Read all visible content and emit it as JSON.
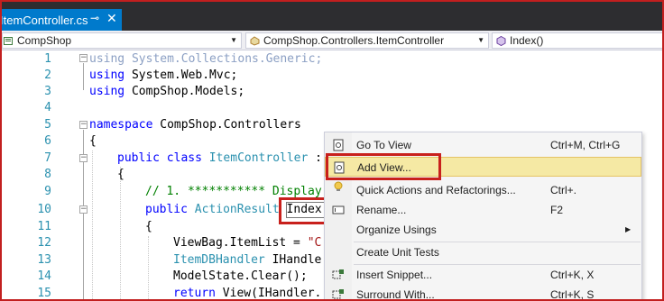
{
  "tab": {
    "title": "ItemController.cs",
    "pin_glyph": "⊸",
    "close_glyph": "✕"
  },
  "navbar": {
    "project": "CompShop",
    "class": "CompShop.Controllers.ItemController",
    "member": "Index()"
  },
  "editor": {
    "line_numbers": [
      "1",
      "2",
      "3",
      "4",
      "5",
      "6",
      "7",
      "8",
      "9",
      "10",
      "11",
      "12",
      "13",
      "14",
      "15"
    ],
    "fold_plus": "+",
    "fold_minus": "−",
    "lines": {
      "l1_kw": "using",
      "l1_rest": " System.Collections.Generic;",
      "l2_kw": "using",
      "l2_rest": " System.Web.Mvc;",
      "l3_kw": "using",
      "l3_rest": " CompShop.Models;",
      "l5_kw": "namespace",
      "l5_rest": " CompShop.Controllers",
      "l6": "{",
      "l7_kw1": "public",
      "l7_kw2": "class",
      "l7_ty": "ItemController",
      "l7_rest": " :",
      "l8": "{",
      "l9": "// 1. *********** Display",
      "l10_kw": "public",
      "l10_ty": "ActionResult",
      "l10_name": "Index",
      "l11": "{",
      "l12_a": "ViewBag.ItemList = ",
      "l12_str": "\"C",
      "l13_ty": "ItemDBHandler",
      "l13_rest": " IHandle",
      "l14": "ModelState.Clear();",
      "l15_kw": "return",
      "l15_rest": " View(IHandler."
    }
  },
  "context_menu": {
    "items": [
      {
        "label": "Go To View",
        "shortcut": "Ctrl+M, Ctrl+G",
        "icon": "go-to-view-icon"
      },
      {
        "label": "Add View...",
        "shortcut": "",
        "icon": "add-view-icon"
      },
      {
        "label": "Quick Actions and Refactorings...",
        "shortcut": "Ctrl+.",
        "icon": "lightbulb-icon"
      },
      {
        "label": "Rename...",
        "shortcut": "F2",
        "icon": "rename-icon"
      },
      {
        "label": "Organize Usings",
        "shortcut": "",
        "icon": "",
        "submenu_glyph": "▶"
      },
      {
        "label": "Create Unit Tests",
        "shortcut": "",
        "icon": ""
      },
      {
        "label": "Insert Snippet...",
        "shortcut": "Ctrl+K, X",
        "icon": "insert-snippet-icon"
      },
      {
        "label": "Surround With...",
        "shortcut": "Ctrl+K, S",
        "icon": "surround-with-icon"
      }
    ]
  },
  "colors": {
    "accent": "#007acc",
    "annotation_red": "#c8201c",
    "menu_highlight": "#f5e9a4",
    "keyword": "#0000ff",
    "type": "#2b91af",
    "comment": "#008000",
    "string": "#a31515",
    "line_number": "#2b91af"
  }
}
